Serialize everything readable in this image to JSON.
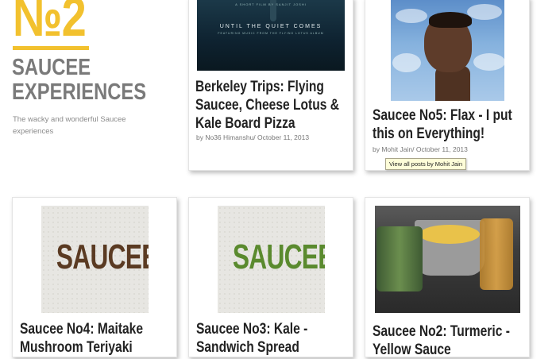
{
  "site": {
    "logo_text": "№2",
    "title": "SAUCEE EXPERIENCES",
    "description": "The wacky and wonderful Saucee experiences"
  },
  "colors": {
    "accent": "#f2c12e",
    "title_gray": "#7a7a7a",
    "saucee_brown": "#5a3a22",
    "saucee_green": "#5a8a2e"
  },
  "posts": [
    {
      "title": "Berkeley Trips: Flying Saucee, Cheese Lotus & Kale Board Pizza",
      "author": "No36 Himanshu",
      "date": "October 11, 2013",
      "thumb": {
        "top_text": "A SHORT FILM BY SANJIT JOSHI",
        "title_text": "UNTIL THE QUIET COMES",
        "sub_text": "FEATURING MUSIC FROM THE FLYING LOTUS ALBUM"
      }
    },
    {
      "title": "Saucee No5: Flax - I put this on Everything!",
      "author": "Mohit Jain",
      "date": "October 11, 2013"
    },
    {
      "title": "Saucee No4: Maitake Mushroom Teriyaki",
      "thumb_word": "SAUCEE"
    },
    {
      "title": "Saucee No3: Kale - Sandwich Spread",
      "thumb_word": "SAUCEE"
    },
    {
      "title": "Saucee No2: Turmeric - Yellow Sauce"
    }
  ],
  "tooltip": "View all posts by Mohit Jain"
}
